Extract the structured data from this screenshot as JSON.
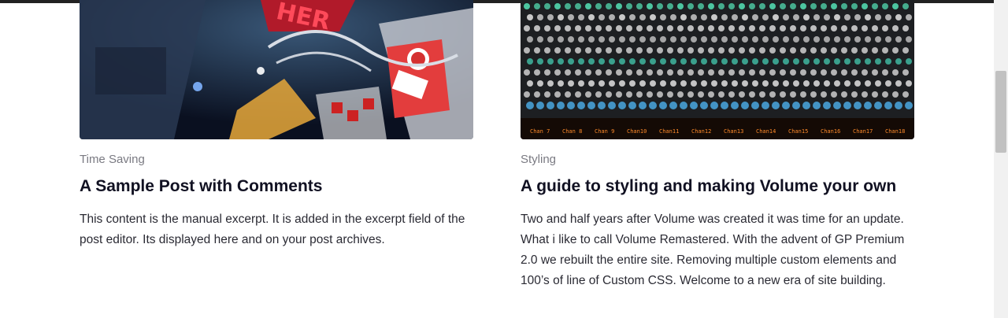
{
  "posts": [
    {
      "category": "Time Saving",
      "title": "A Sample Post with Comments",
      "excerpt": "This content is the manual excerpt. It is added in the excerpt field of the post editor. Its displayed here and on your post archives.",
      "image_label": "pinball machine photo"
    },
    {
      "category": "Styling",
      "title": "A guide to styling and making Volume your own",
      "excerpt": "Two and half years after Volume was created it was time for an update. What i like to call Volume Remastered. With the advent of GP Premium 2.0 we rebuilt the entire site. Removing multiple custom elements and 100’s of line of Custom CSS. Welcome to a new era of site building.",
      "image_label": "mixing console photo",
      "console_labels": [
        "Chan 7",
        "Chan 8",
        "Chan 9",
        "Chan10",
        "Chan11",
        "Chan12",
        "Chan13",
        "Chan14",
        "Chan15",
        "Chan16",
        "Chan17",
        "Chan18"
      ]
    }
  ],
  "colors": {
    "topbar": "#222222",
    "title": "#111122",
    "category": "#7a7a82",
    "body_text": "#2a2a33"
  }
}
